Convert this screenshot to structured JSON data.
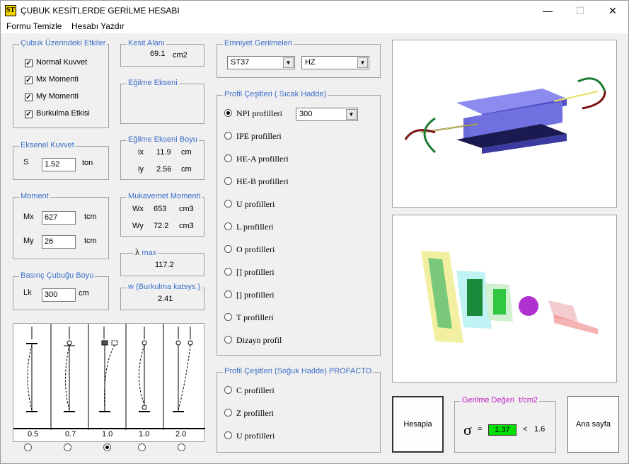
{
  "window": {
    "title": "ÇUBUK KESİTLERDE GERİLME HESABI",
    "icon_text": "ST",
    "min": "—",
    "max": "☐",
    "close": "✕"
  },
  "menu": [
    "Formu Temizle",
    "Hesabı Yazdır"
  ],
  "effects": {
    "label": "Çubuk Üzerindeki Etkiler",
    "items": [
      {
        "label": "Normal Kuvvet",
        "checked": true
      },
      {
        "label": "Mx Momenti",
        "checked": true
      },
      {
        "label": "My Momenti",
        "checked": true
      },
      {
        "label": "Burkulma Etkisi",
        "checked": true
      }
    ]
  },
  "axial": {
    "label": "Eksenel Kuvvet",
    "name": "S",
    "value": "1.52",
    "unit": "ton"
  },
  "moment": {
    "label": "Moment",
    "mx_name": "Mx",
    "mx_value": "627",
    "mx_unit": "tcm",
    "my_name": "My",
    "my_value": "26",
    "my_unit": "tcm"
  },
  "buckle_len": {
    "label": "Basınç Çubuğu Boyu",
    "name": "Lk",
    "value": "300",
    "unit": "cm"
  },
  "section_area": {
    "label": "Kesit Alanı",
    "value": "69.1",
    "unit": "cm2"
  },
  "bend_axis": {
    "label": "Eğilme Ekseni"
  },
  "gyration": {
    "label": "Eğilme Ekseni Boyu",
    "ix_name": "ix",
    "ix_value": "11.9",
    "ix_unit": "cm",
    "iy_name": "iy",
    "iy_value": "2.56",
    "iy_unit": "cm"
  },
  "resist": {
    "label": "Mukavemet Momenti",
    "wx_name": "Wx",
    "wx_value": "653",
    "wx_unit": "cm3",
    "wy_name": "Wy",
    "wy_value": "72.2",
    "wy_unit": "cm3"
  },
  "lambda": {
    "symbol": "λ",
    "label": "max",
    "value": "117.2"
  },
  "omega": {
    "label": "w (Burkulma katsys.)",
    "value": "2.41"
  },
  "safety": {
    "label": "Emniyet Gerilmeleri",
    "steel": "ST37",
    "load": "HZ"
  },
  "hot_profiles": {
    "label": "Profil Çeşitleri ( Sıcak Hadde)",
    "items": [
      "NPI profilleri",
      "IPE profilleri",
      "HE-A profilleri",
      "HE-B profilleri",
      "U profilleri",
      "L profilleri",
      "O profilleri",
      "[]  profilleri",
      "[] profilleri",
      "T profilleri",
      "Dizayn profil"
    ],
    "selected": 0,
    "size": "300"
  },
  "cold_profiles": {
    "label": "Profil Çeşitleri (Soğuk Hadde) PROFACTO",
    "items": [
      "C profilleri",
      "Z profilleri",
      "U profilleri"
    ]
  },
  "buckling_cases": {
    "factors": [
      "0.5",
      "0.7",
      "1.0",
      "1.0",
      "2.0"
    ],
    "selected": 2
  },
  "calc_button": "Hesapla",
  "home_button": "Ana sayfa",
  "stress": {
    "label": "Gerilme Değeri",
    "unit": "t/cm2",
    "symbol": "σ",
    "eq": "=",
    "value": "1.37",
    "cmp": "<",
    "limit": "1.6"
  }
}
